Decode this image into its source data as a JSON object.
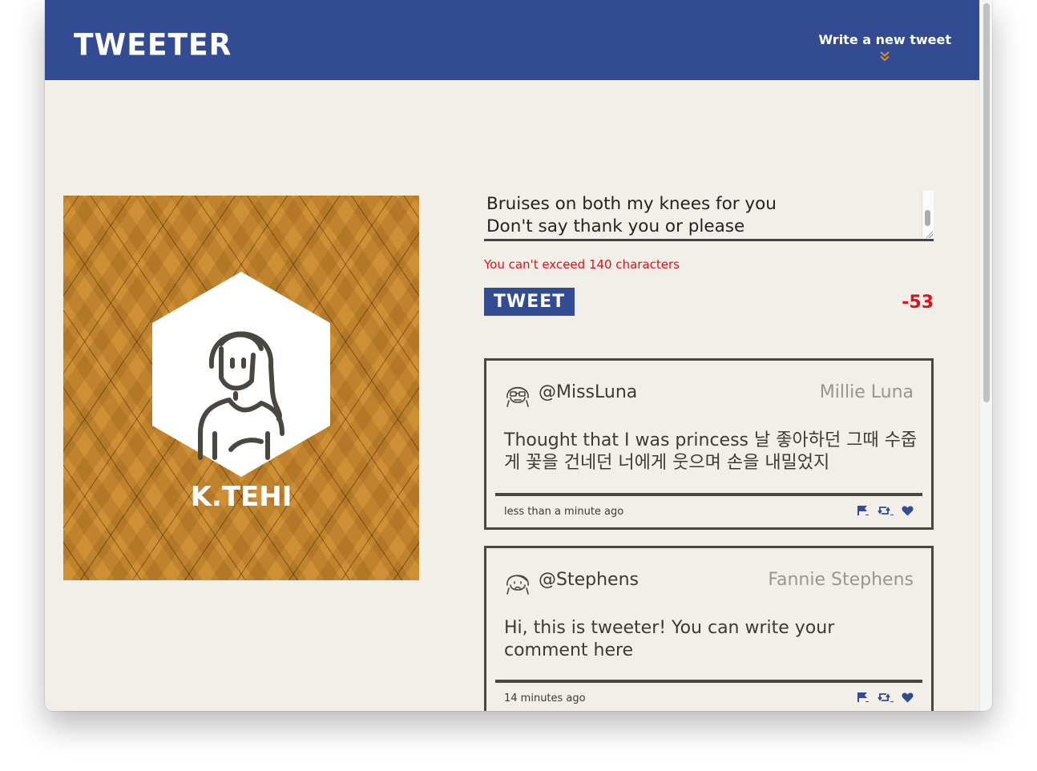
{
  "header": {
    "logo": "TWEETER",
    "compose_toggle": "Write a new tweet",
    "brand_color": "#334b92",
    "accent_color": "#e08a2a"
  },
  "profile": {
    "name": "K.TEHI",
    "background_color": "#cf8f35"
  },
  "compose": {
    "text": "Bruises on both my knees for you\nDon't say thank you or please",
    "error": "You can't exceed 140 characters",
    "submit_label": "TWEET",
    "counter": "-53",
    "error_color": "#e0111b"
  },
  "tweets": [
    {
      "handle": "@MissLuna",
      "full_name": "Millie Luna",
      "content": "Thought that I was princess 날 좋아하던 그때 수줍게 꽃을 건네던 너에게 웃으며 손을 내밀었지",
      "time": "less than a minute ago",
      "avatar_icon": "girl-glasses-avatar-icon"
    },
    {
      "handle": "@Stephens",
      "full_name": "Fannie Stephens",
      "content": "Hi, this is tweeter! You can write your comment here",
      "time": "14 minutes ago",
      "avatar_icon": "girl-avatar-icon"
    }
  ],
  "actions": [
    "flag-icon",
    "retweet-icon",
    "heart-icon"
  ]
}
